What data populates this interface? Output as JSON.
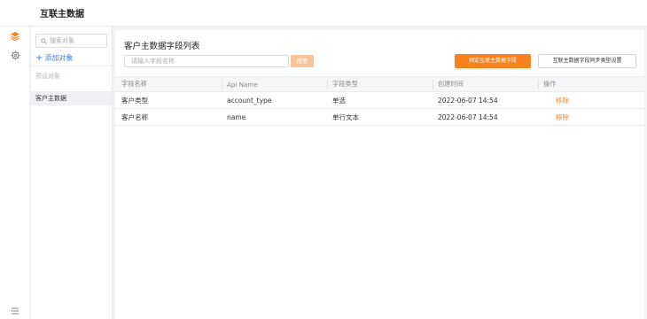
{
  "header": {
    "title": "互联主数据"
  },
  "rail": {
    "icons": [
      "layers-icon",
      "gear-icon",
      "list-settings-icon"
    ]
  },
  "object_panel": {
    "search_placeholder": "搜索对象",
    "add_label": "添加对象",
    "section_label": "预设对象",
    "items": [
      {
        "label": "客户主数据"
      }
    ]
  },
  "main": {
    "heading": "客户主数据字段列表",
    "field_search_placeholder": "请输入字段名称",
    "search_button": "搜索",
    "primary_button": "预定互联主数据字段",
    "secondary_button": "互联主数据字段同步类型设置",
    "table": {
      "columns": [
        "字段名称",
        "Api Name",
        "字段类型",
        "创建时间",
        "操作"
      ],
      "rows": [
        {
          "name": "客户类型",
          "api": "account_type",
          "type": "单选",
          "created": "2022-06-07 14:54",
          "action": "移除"
        },
        {
          "name": "客户名称",
          "api": "name",
          "type": "单行文本",
          "created": "2022-06-07 14:54",
          "action": "移除"
        }
      ]
    }
  },
  "colors": {
    "accent": "#f7821d",
    "link": "#3a7be8",
    "action": "#f08a2c"
  }
}
